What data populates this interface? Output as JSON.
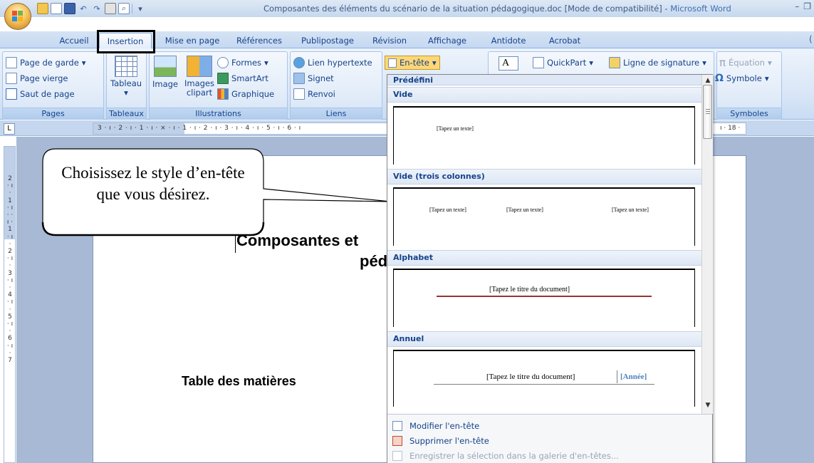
{
  "window": {
    "title": "Composantes des éléments du scénario de la situation pédagogique.doc [Mode de compatibilité] - ",
    "app_name": "Microsoft Word",
    "controls": {
      "minimize": "–",
      "restore": "❐"
    }
  },
  "quick_access": {
    "save_icon": "save-icon",
    "undo_icon": "undo-icon",
    "redo_icon": "redo-icon",
    "print_icon": "print-icon",
    "preview_icon": "print-preview-icon",
    "more_icon": "customize-toolbar-icon",
    "more_glyph": "▾"
  },
  "tabs": [
    {
      "label": "Accueil"
    },
    {
      "label": "Insertion"
    },
    {
      "label": "Mise en page"
    },
    {
      "label": "Références"
    },
    {
      "label": "Publipostage"
    },
    {
      "label": "Révision"
    },
    {
      "label": "Affichage"
    },
    {
      "label": "Antidote"
    },
    {
      "label": "Acrobat"
    }
  ],
  "ribbon": {
    "pages": {
      "label": "Pages",
      "items": [
        "Page de garde",
        "Page vierge",
        "Saut de page"
      ],
      "cover_arrow": "▾"
    },
    "tableaux": {
      "label": "Tableaux",
      "table": "Tableau",
      "arrow": "▾"
    },
    "illustrations": {
      "label": "Illustrations",
      "image": "Image",
      "clipart_1": "Images",
      "clipart_2": "clipart",
      "shapes": "Formes",
      "smartart": "SmartArt",
      "chart": "Graphique",
      "arrow": "▾"
    },
    "liens": {
      "label": "Liens",
      "hyperlink": "Lien hypertexte",
      "bookmark": "Signet",
      "crossref": "Renvoi"
    },
    "header_button": {
      "label": "En-tête",
      "arrow": "▾"
    },
    "text": {
      "textbox_glyph": "A",
      "quickpart": "QuickPart",
      "signature": "Ligne de signature",
      "arrow": "▾"
    },
    "symboles": {
      "label": "Symboles",
      "equation": "Équation",
      "equation_glyph": "π",
      "symbol": "Symbole",
      "symbol_glyph": "Ω",
      "arrow": "▾"
    },
    "help_glyph": "("
  },
  "ruler": {
    "tab_selector": "L",
    "horizontal_ticks": "3 · ı · 2 · ı · 1 · ı · ⨯ · ı · 1 · ı · 2 · ı · 3 · ı · 4 · ı · 5 · ı · 6 · ı",
    "right_ticks": "ı · 18 ·",
    "vertical_ticks": "2 · ı · 1 · ı · · ı · 1 · ı · 2 · ı · 3 · ı · 4 · ı · 5 · ı · 6 · ı · 7"
  },
  "document": {
    "title_line_1": "Composantes et",
    "title_line_2": "péd",
    "toc_heading": "Table des matières"
  },
  "callout": {
    "text": "Choisissez le style d’en-tête que vous désirez."
  },
  "gallery": {
    "header": "Prédéfini",
    "categories": [
      {
        "name": "Vide",
        "placeholder": "[Tapez un texte]"
      },
      {
        "name": "Vide (trois colonnes)",
        "placeholders": [
          "[Tapez un texte]",
          "[Tapez un texte]",
          "[Tapez un texte]"
        ]
      },
      {
        "name": "Alphabet",
        "placeholder": "[Tapez le titre du document]"
      },
      {
        "name": "Annuel",
        "placeholder": "[Tapez le titre du document]",
        "year": "[Année]"
      }
    ],
    "scroll": {
      "up": "▲",
      "down": "▼"
    },
    "menu": [
      {
        "label": "Modifier l'en-tête",
        "enabled": true
      },
      {
        "label": "Supprimer l'en-tête",
        "enabled": true
      },
      {
        "label": "Enregistrer la sélection dans la galerie d'en-têtes...",
        "enabled": false
      }
    ]
  },
  "colors": {
    "ribbon_text": "#15428b",
    "alphabet_rule": "#943634",
    "annuel_rule": "#808080",
    "annuel_year": "#4f81bd",
    "header_button_bg": "#fdd777"
  }
}
